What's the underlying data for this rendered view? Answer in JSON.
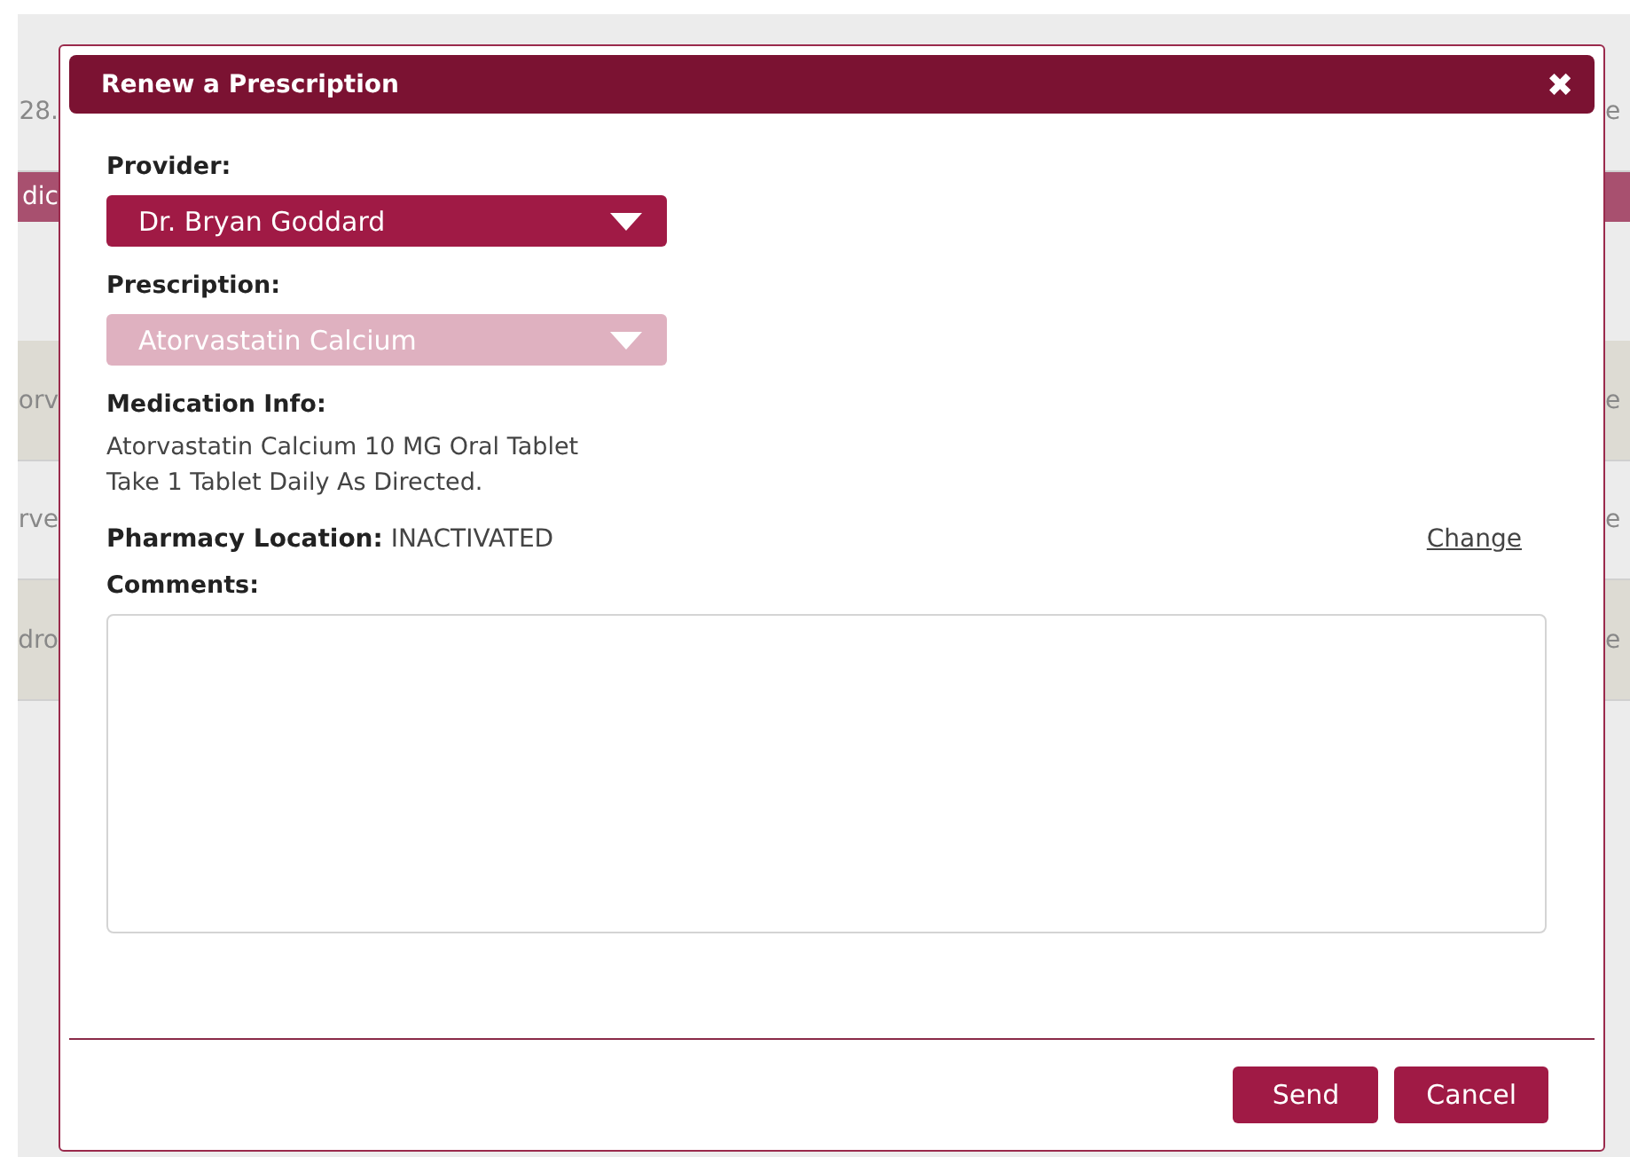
{
  "background": {
    "left": [
      {
        "kind": "plain",
        "text": "28."
      },
      {
        "kind": "bar",
        "text": "dic"
      },
      {
        "kind": "gap"
      },
      {
        "kind": "shaded",
        "text": "orv"
      },
      {
        "kind": "plain",
        "text": "rve"
      },
      {
        "kind": "shaded",
        "text": "dro"
      }
    ],
    "right": [
      {
        "kind": "plain",
        "text": "e"
      },
      {
        "kind": "bar"
      },
      {
        "kind": "gap"
      },
      {
        "kind": "shaded",
        "text": "e"
      },
      {
        "kind": "plain",
        "text": "e"
      },
      {
        "kind": "shaded",
        "text": "e"
      }
    ]
  },
  "dialog": {
    "title": "Renew a Prescription",
    "close": "✖",
    "provider": {
      "label": "Provider:",
      "value": "Dr. Bryan Goddard",
      "disabled": false
    },
    "prescription": {
      "label": "Prescription:",
      "value": "Atorvastatin Calcium",
      "disabled": true
    },
    "medication": {
      "label": "Medication Info:",
      "lines": [
        "Atorvastatin Calcium 10 MG Oral Tablet",
        "Take 1 Tablet Daily As Directed."
      ]
    },
    "pharmacy": {
      "label": "Pharmacy Location:",
      "value": "INACTIVATED",
      "link": "Change"
    },
    "comments": {
      "label": "Comments:"
    },
    "buttons": [
      "Send",
      "Cancel"
    ]
  }
}
